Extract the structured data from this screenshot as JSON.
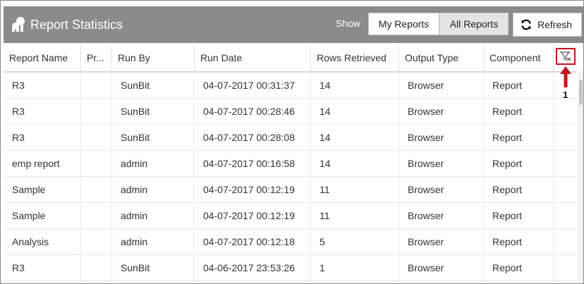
{
  "header": {
    "title": "Report Statistics",
    "show_label": "Show",
    "my_reports_label": "My Reports",
    "all_reports_label": "All Reports",
    "refresh_label": "Refresh",
    "active_view": "All Reports"
  },
  "table": {
    "columns": [
      "Report Name",
      "Pr...",
      "Run By",
      "Run Date",
      "Rows Retrieved",
      "Output Type",
      "Component"
    ],
    "rows": [
      [
        "R3",
        "",
        "SunBit",
        "04-07-2017 00:31:37",
        "14",
        "Browser",
        "Report"
      ],
      [
        "R3",
        "",
        "SunBit",
        "04-07-2017 00:28:46",
        "14",
        "Browser",
        "Report"
      ],
      [
        "R3",
        "",
        "SunBit",
        "04-07-2017 00:28:08",
        "14",
        "Browser",
        "Report"
      ],
      [
        "emp report",
        "",
        "admin",
        "04-07-2017 00:16:58",
        "14",
        "Browser",
        "Report"
      ],
      [
        "Sample",
        "",
        "admin",
        "04-07-2017 00:12:19",
        "11",
        "Browser",
        "Report"
      ],
      [
        "Sample",
        "",
        "admin",
        "04-07-2017 00:12:19",
        "11",
        "Browser",
        "Report"
      ],
      [
        "Analysis",
        "",
        "admin",
        "04-07-2017 00:12:18",
        "5",
        "Browser",
        "Report"
      ],
      [
        "R3",
        "",
        "SunBit",
        "04-06-2017 23:53:26",
        "1",
        "Browser",
        "Report"
      ]
    ]
  },
  "annotation": {
    "callout_number": "1"
  },
  "colors": {
    "header_bg": "#8b8b8b",
    "highlight": "#c0151b"
  },
  "icons": {
    "logo": "reports-logo-icon",
    "refresh": "refresh-icon",
    "filter": "filter-icon",
    "arrow": "arrow-up-icon"
  }
}
